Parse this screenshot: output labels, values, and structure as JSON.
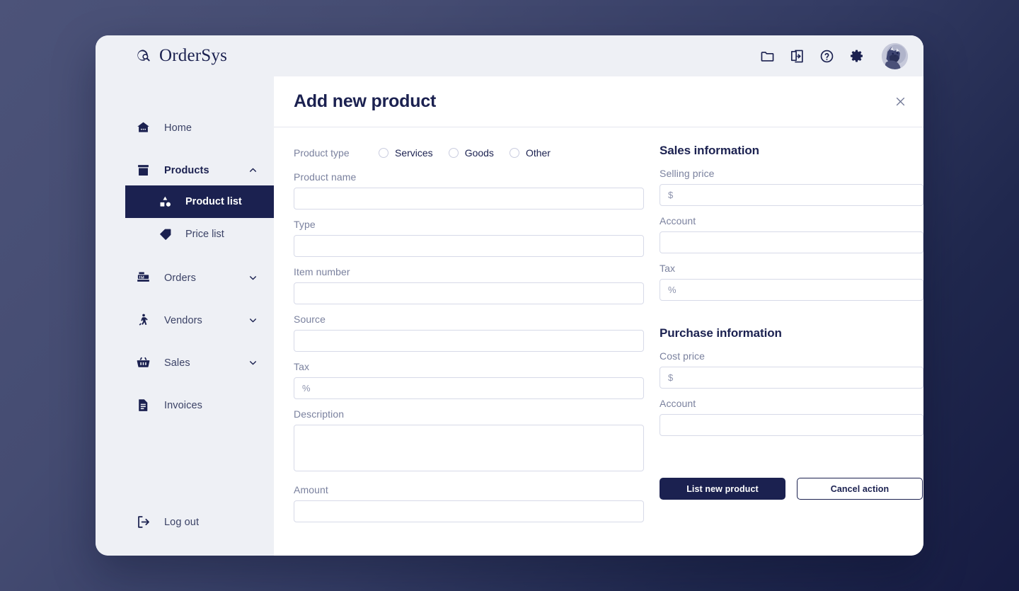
{
  "brand": {
    "name": "OrderSys",
    "logo_icon": "magnifier-circle-icon"
  },
  "sidebar": {
    "items": [
      {
        "label": "Home",
        "icon": "home-icon",
        "expandable": false
      },
      {
        "label": "Products",
        "icon": "archive-box-icon",
        "expandable": true,
        "expanded": true,
        "chevron": "chevron-up-icon"
      },
      {
        "label": "Orders",
        "icon": "cash-register-icon",
        "expandable": true,
        "expanded": false,
        "chevron": "chevron-down-icon"
      },
      {
        "label": "Vendors",
        "icon": "walking-person-icon",
        "expandable": true,
        "expanded": false,
        "chevron": "chevron-down-icon"
      },
      {
        "label": "Sales",
        "icon": "basket-icon",
        "expandable": true,
        "expanded": false,
        "chevron": "chevron-down-icon"
      },
      {
        "label": "Invoices",
        "icon": "document-icon",
        "expandable": false
      }
    ],
    "subitems": [
      {
        "label": "Product list",
        "icon": "shapes-icon",
        "active": true
      },
      {
        "label": "Price list",
        "icon": "tag-icon",
        "active": false
      }
    ],
    "logout": {
      "label": "Log out",
      "icon": "logout-icon"
    }
  },
  "topbar": {
    "icons": [
      {
        "name": "folder-icon"
      },
      {
        "name": "export-document-icon"
      },
      {
        "name": "help-circle-icon"
      },
      {
        "name": "gear-icon"
      }
    ],
    "avatar": "user-avatar"
  },
  "panel": {
    "title": "Add new product",
    "close_icon": "close-icon"
  },
  "form": {
    "product_type": {
      "label": "Product type",
      "options": [
        {
          "label": "Services",
          "selected": false
        },
        {
          "label": "Goods",
          "selected": false
        },
        {
          "label": "Other",
          "selected": false
        }
      ]
    },
    "left_fields": [
      {
        "label": "Product name",
        "value": "",
        "placeholder": "",
        "type": "input"
      },
      {
        "label": "Type",
        "value": "",
        "placeholder": "",
        "type": "input"
      },
      {
        "label": "Item number",
        "value": "",
        "placeholder": "",
        "type": "input"
      },
      {
        "label": "Source",
        "value": "",
        "placeholder": "",
        "type": "input"
      },
      {
        "label": "Tax",
        "value": "",
        "placeholder": "%",
        "type": "input"
      },
      {
        "label": "Description",
        "value": "",
        "placeholder": "",
        "type": "textarea"
      },
      {
        "label": "Amount",
        "value": "",
        "placeholder": "",
        "type": "input"
      }
    ],
    "sales_section": {
      "title": "Sales information",
      "fields": [
        {
          "label": "Selling price",
          "value": "",
          "placeholder": "$"
        },
        {
          "label": "Account",
          "value": "",
          "placeholder": ""
        },
        {
          "label": "Tax",
          "value": "",
          "placeholder": "%"
        }
      ]
    },
    "purchase_section": {
      "title": "Purchase information",
      "fields": [
        {
          "label": "Cost price",
          "value": "",
          "placeholder": "$"
        },
        {
          "label": "Account",
          "value": "",
          "placeholder": ""
        }
      ]
    },
    "buttons": {
      "primary": "List new product",
      "secondary": "Cancel action"
    }
  },
  "colors": {
    "navy": "#1b2150",
    "sidebar_bg": "#eef0f5",
    "label_gray": "#7a819e",
    "border": "#d7dae8",
    "page_bg_from": "#4c5379",
    "page_bg_to": "#161b42"
  }
}
